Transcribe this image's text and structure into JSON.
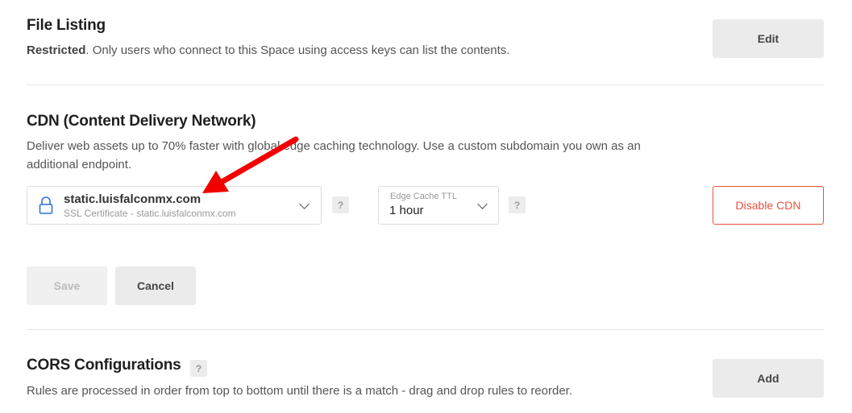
{
  "file_listing": {
    "title": "File Listing",
    "desc_bold": "Restricted",
    "desc_rest": ". Only users who connect to this Space using access keys can list the contents.",
    "edit_label": "Edit"
  },
  "cdn": {
    "title": "CDN (Content Delivery Network)",
    "desc": "Deliver web assets up to 70% faster with global edge caching technology. Use a custom subdomain you own as an additional endpoint.",
    "endpoint": {
      "value": "static.luisfalconmx.com",
      "sub": "SSL Certificate - static.luisfalconmx.com"
    },
    "ttl": {
      "label": "Edge Cache TTL",
      "value": "1 hour"
    },
    "help": "?",
    "disable_label": "Disable CDN",
    "save_label": "Save",
    "cancel_label": "Cancel"
  },
  "cors": {
    "title": "CORS Configurations",
    "help": "?",
    "desc": "Rules are processed in order from top to bottom until there is a match - drag and drop rules to reorder.",
    "add_label": "Add"
  },
  "colors": {
    "danger": "#e8533f",
    "arrow": "#f20000"
  }
}
